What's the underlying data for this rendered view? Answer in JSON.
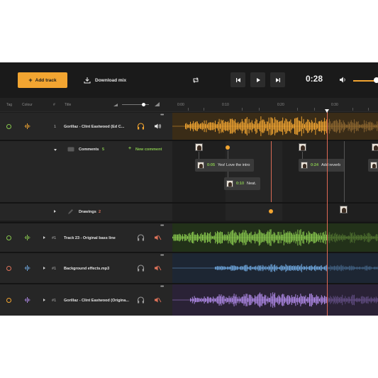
{
  "toolbar": {
    "add_track_label": "Add track",
    "download_mix_label": "Download mix",
    "time": "0:28"
  },
  "colors": {
    "accent": "#f2a531",
    "green": "#88c84e",
    "blue": "#6fa8e0",
    "purple": "#b08ae8",
    "playhead": "#e06a55"
  },
  "header": {
    "tag": "Tag",
    "colour": "Colour",
    "number": "#",
    "title": "Title",
    "ruler": [
      "0:00",
      "0:10",
      "0:20",
      "0:30"
    ]
  },
  "tracks": [
    {
      "number": "1",
      "title": "Gorillaz - Clint Eastwood (Ed C...",
      "color": "#f2a531",
      "tag_color": "#88c84e",
      "icon": "headphones-icon",
      "volume_icon": "speaker-icon"
    },
    {
      "number": "#1",
      "title": "Track 23 - Original bass line",
      "color": "#88c84e",
      "tag_color": "#88c84e",
      "icon": "headphones-icon",
      "volume_icon": "speaker-muted-icon"
    },
    {
      "number": "#1",
      "title": "Background effects.mp3",
      "color": "#6fa8e0",
      "tag_color": "#e0735a",
      "icon": "headphones-icon",
      "volume_icon": "speaker-muted-icon"
    },
    {
      "number": "#1",
      "title": "Gorillaz - Clint Eastwood (Origina...",
      "color": "#b08ae8",
      "tag_color": "#f2a531",
      "icon": "headphones-icon",
      "volume_icon": "speaker-muted-icon"
    }
  ],
  "comments": {
    "label": "Comments",
    "count": "5",
    "new_comment_label": "New comment",
    "items": [
      {
        "time": "0:05",
        "text": "Yes! Love the intro"
      },
      {
        "time": "0:10",
        "text": "Neat."
      },
      {
        "time": "0:24",
        "text": "Add reverb"
      }
    ]
  },
  "drawings": {
    "label": "Drawings",
    "count": "2"
  }
}
